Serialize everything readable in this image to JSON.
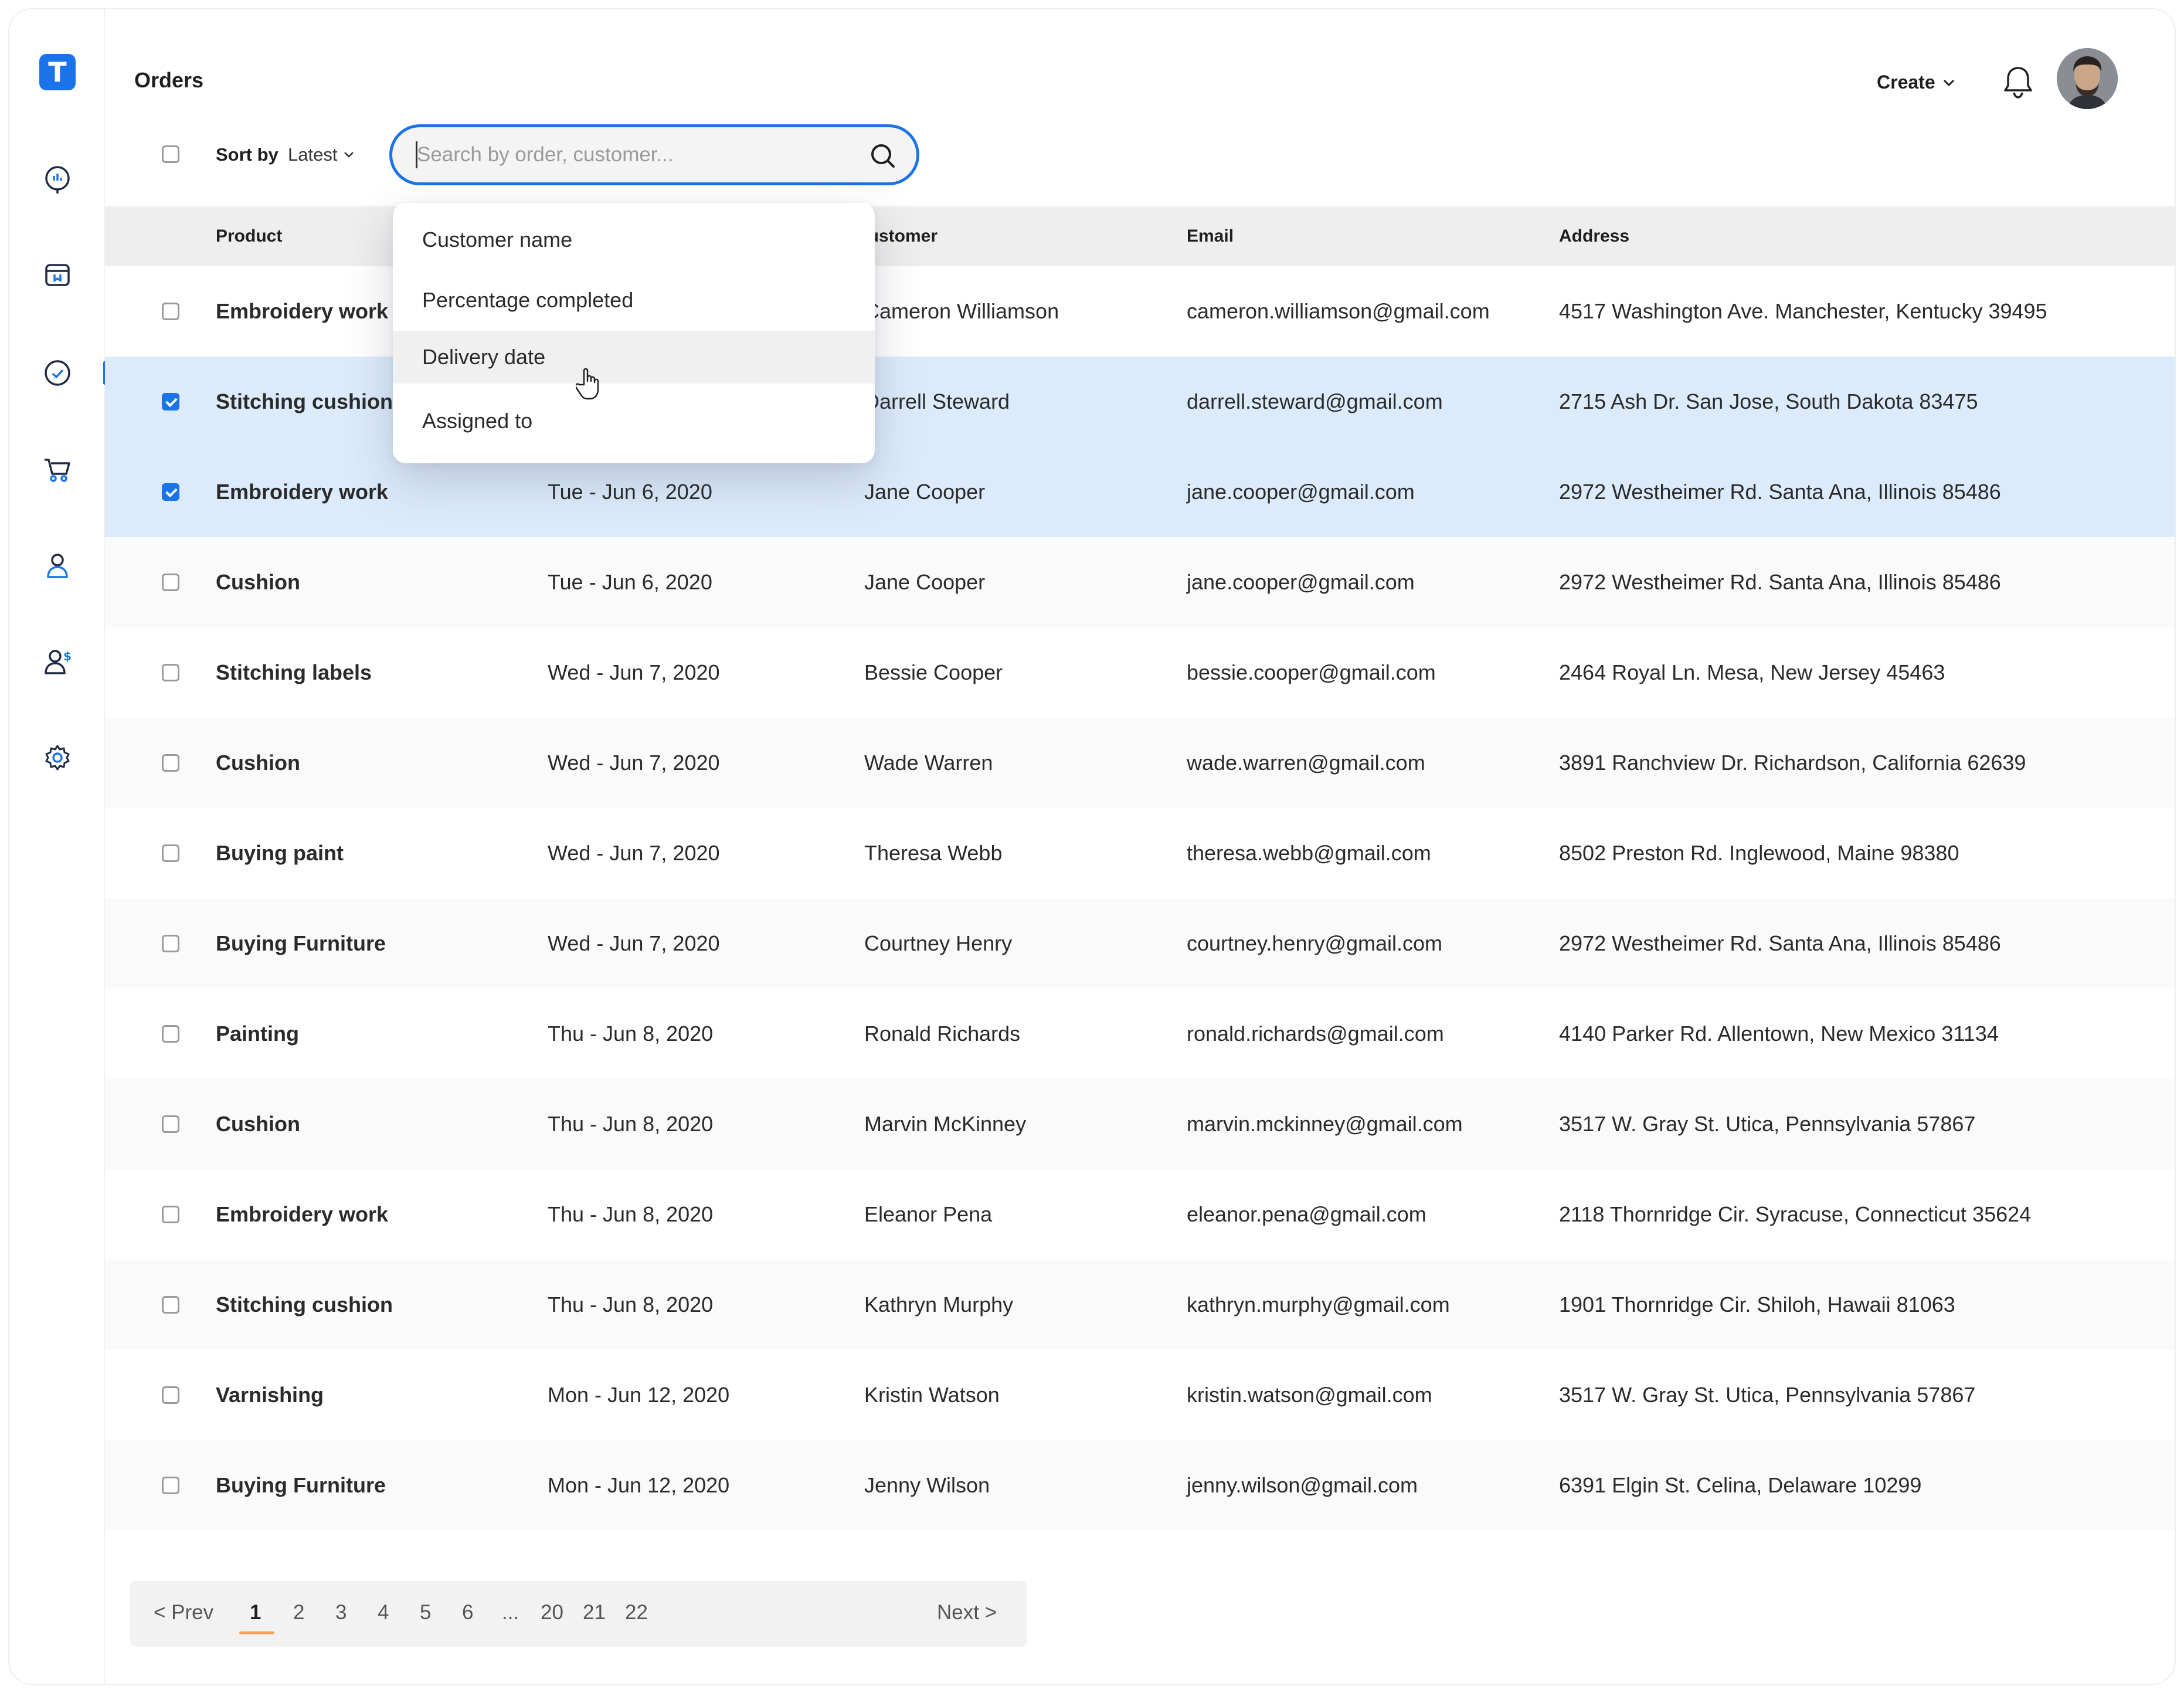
{
  "app": {
    "logo_letter": "T"
  },
  "header": {
    "title": "Orders",
    "create_label": "Create"
  },
  "sidebar": {
    "items": [
      {
        "name": "dashboard"
      },
      {
        "name": "store"
      },
      {
        "name": "tasks"
      },
      {
        "name": "cart"
      },
      {
        "name": "user"
      },
      {
        "name": "user-billing"
      },
      {
        "name": "settings"
      }
    ]
  },
  "toolbar": {
    "sort_label": "Sort by",
    "sort_value": "Latest",
    "search_placeholder": "Search by order, customer..."
  },
  "dropdown": {
    "items": [
      "Customer name",
      "Percentage completed",
      "Delivery date",
      "Assigned to"
    ],
    "hovered_index": 2
  },
  "table": {
    "columns": [
      "Product",
      "Customer",
      "Email",
      "Address"
    ],
    "rows": [
      {
        "product": "Embroidery work",
        "date": "",
        "customer": "Cameron Williamson",
        "email": "cameron.williamson@gmail.com",
        "address": "4517 Washington Ave. Manchester, Kentucky 39495",
        "checked": false
      },
      {
        "product": "Stitching cushion",
        "date": "",
        "customer": "Darrell Steward",
        "email": "darrell.steward@gmail.com",
        "address": "2715 Ash Dr. San Jose, South Dakota 83475",
        "checked": true
      },
      {
        "product": "Embroidery work",
        "date": "Tue - Jun 6, 2020",
        "customer": "Jane Cooper",
        "email": "jane.cooper@gmail.com",
        "address": "2972 Westheimer Rd. Santa Ana, Illinois 85486",
        "checked": true
      },
      {
        "product": "Cushion",
        "date": "Tue - Jun 6, 2020",
        "customer": "Jane Cooper",
        "email": "jane.cooper@gmail.com",
        "address": "2972 Westheimer Rd. Santa Ana, Illinois 85486",
        "checked": false
      },
      {
        "product": "Stitching labels",
        "date": "Wed - Jun 7, 2020",
        "customer": "Bessie Cooper",
        "email": "bessie.cooper@gmail.com",
        "address": "2464 Royal Ln. Mesa, New Jersey 45463",
        "checked": false
      },
      {
        "product": "Cushion",
        "date": "Wed - Jun 7, 2020",
        "customer": "Wade Warren",
        "email": "wade.warren@gmail.com",
        "address": "3891 Ranchview Dr. Richardson, California 62639",
        "checked": false
      },
      {
        "product": "Buying paint",
        "date": "Wed - Jun 7, 2020",
        "customer": "Theresa Webb",
        "email": "theresa.webb@gmail.com",
        "address": "8502 Preston Rd. Inglewood, Maine 98380",
        "checked": false
      },
      {
        "product": "Buying Furniture",
        "date": "Wed - Jun 7, 2020",
        "customer": "Courtney Henry",
        "email": "courtney.henry@gmail.com",
        "address": "2972 Westheimer Rd. Santa Ana, Illinois 85486",
        "checked": false
      },
      {
        "product": "Painting",
        "date": "Thu - Jun 8, 2020",
        "customer": "Ronald Richards",
        "email": "ronald.richards@gmail.com",
        "address": "4140 Parker Rd. Allentown, New Mexico 31134",
        "checked": false
      },
      {
        "product": "Cushion",
        "date": "Thu - Jun 8, 2020",
        "customer": "Marvin McKinney",
        "email": "marvin.mckinney@gmail.com",
        "address": "3517 W. Gray St. Utica, Pennsylvania 57867",
        "checked": false
      },
      {
        "product": "Embroidery work",
        "date": "Thu - Jun 8, 2020",
        "customer": "Eleanor Pena",
        "email": "eleanor.pena@gmail.com",
        "address": "2118 Thornridge Cir. Syracuse, Connecticut 35624",
        "checked": false
      },
      {
        "product": "Stitching cushion",
        "date": "Thu - Jun 8, 2020",
        "customer": "Kathryn Murphy",
        "email": "kathryn.murphy@gmail.com",
        "address": "1901 Thornridge Cir. Shiloh, Hawaii 81063",
        "checked": false
      },
      {
        "product": "Varnishing",
        "date": "Mon - Jun 12, 2020",
        "customer": "Kristin Watson",
        "email": "kristin.watson@gmail.com",
        "address": "3517 W. Gray St. Utica, Pennsylvania 57867",
        "checked": false
      },
      {
        "product": "Buying Furniture",
        "date": "Mon - Jun 12, 2020",
        "customer": "Jenny Wilson",
        "email": "jenny.wilson@gmail.com",
        "address": "6391 Elgin St. Celina, Delaware 10299",
        "checked": false
      }
    ]
  },
  "pagination": {
    "prev": "< Prev",
    "next": "Next >",
    "pages": [
      "1",
      "2",
      "3",
      "4",
      "5",
      "6",
      "...",
      "20",
      "21",
      "22"
    ],
    "current": "1"
  },
  "colors": {
    "accent": "#1a73e8",
    "selected_row": "#dcebfb",
    "page_underline": "#f0a35a"
  }
}
